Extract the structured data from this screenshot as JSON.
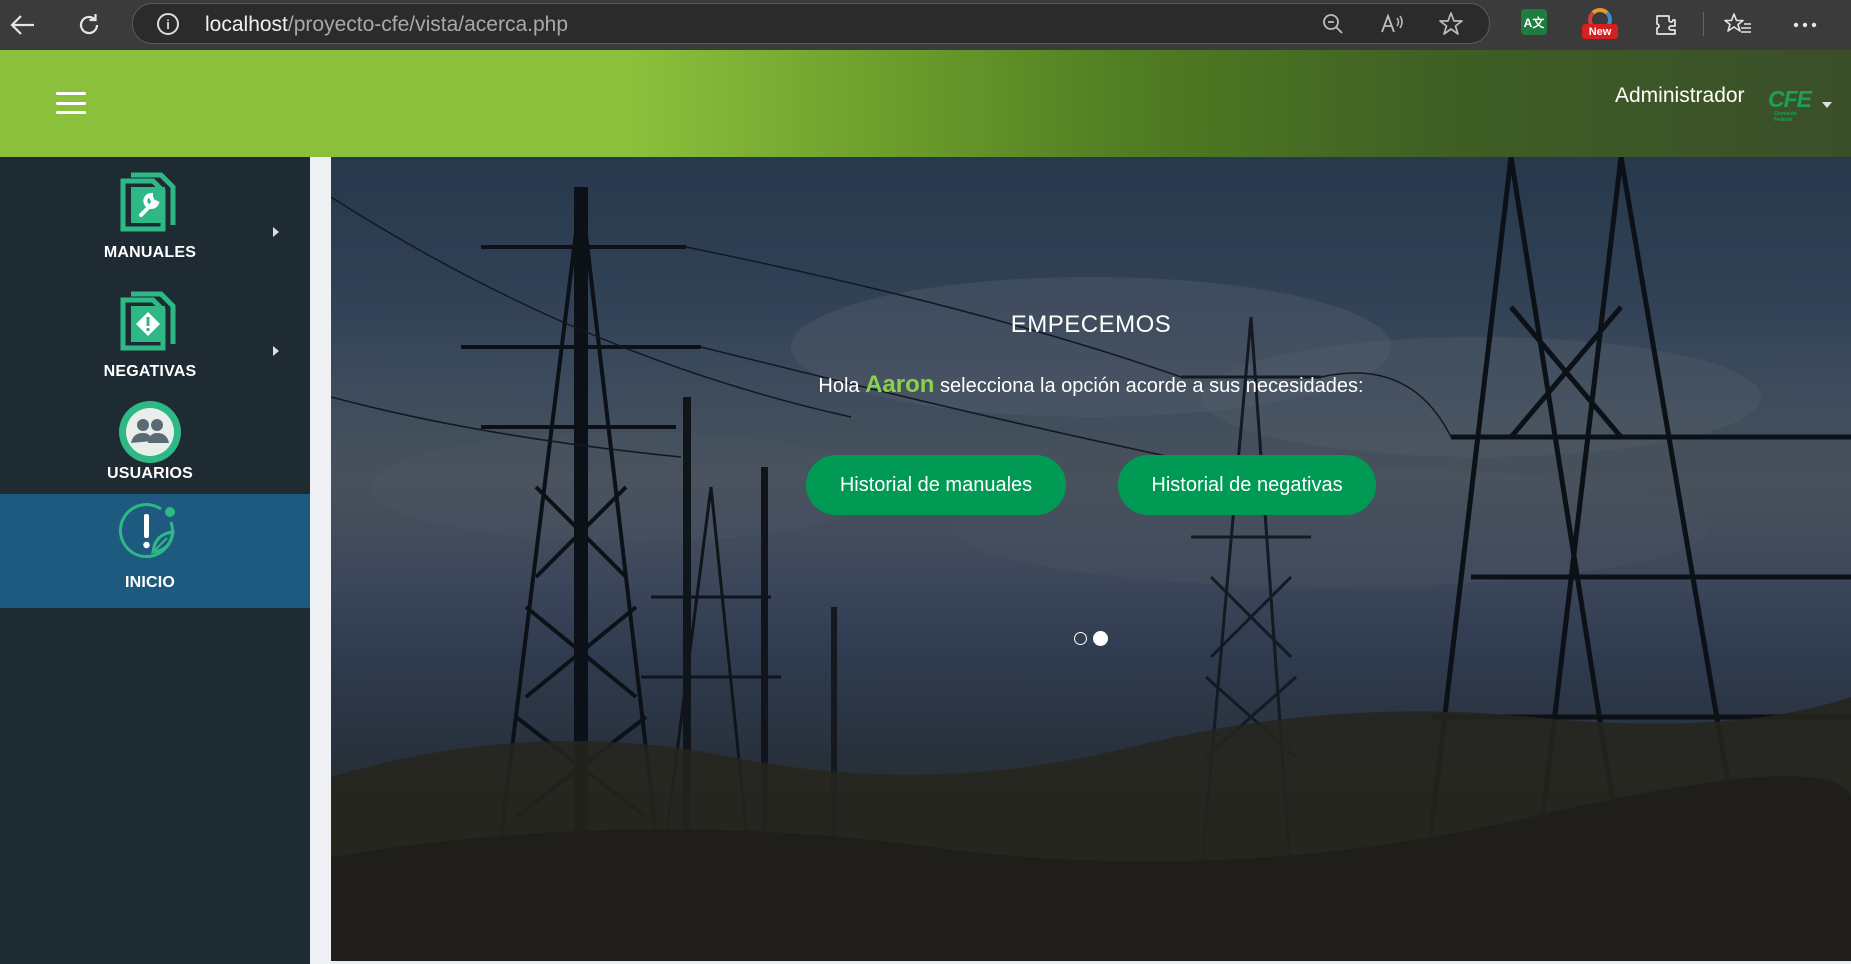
{
  "browser": {
    "url_host": "localhost",
    "url_path": "/proyecto-cfe/vista/acerca.php",
    "new_badge": "New",
    "translate_badge": "A文",
    "icons": [
      "back-icon",
      "refresh-icon",
      "info-icon",
      "zoom-out-icon",
      "read-aloud-icon",
      "favorite-star-icon",
      "translate-extension-icon",
      "new-extension-icon",
      "extensions-puzzle-icon",
      "favorites-list-icon",
      "more-options-icon"
    ]
  },
  "header": {
    "user_label": "Administrador",
    "logo_text": "CFE",
    "logo_tagline": "Comisión Federal",
    "colors": {
      "bar_start": "#8bc03c",
      "bar_end": "#3a4e2a"
    }
  },
  "sidebar": {
    "items": [
      {
        "label": "MANUALES",
        "icon": "manual-wrench-icon",
        "has_submenu": true
      },
      {
        "label": "NEGATIVAS",
        "icon": "negative-warning-icon",
        "has_submenu": true
      },
      {
        "label": "USUARIOS",
        "icon": "users-icon",
        "has_submenu": false
      },
      {
        "label": "INICIO",
        "icon": "home-leaf-alert-icon",
        "has_submenu": false,
        "active": true
      }
    ],
    "colors": {
      "background": "#1e2b33",
      "active": "#1e5a80",
      "accent": "#2eb886"
    }
  },
  "hero": {
    "title": "EMPECEMOS",
    "greeting_prefix": "Hola",
    "user_name": "Aaron",
    "greeting_suffix": "selecciona la opción acorde a sus necesidades:",
    "buttons": [
      "Historial de manuales",
      "Historial de negativas"
    ],
    "carousel": {
      "slides": 2,
      "active_slide": 2
    },
    "colors": {
      "button": "#009a55",
      "name": "#8bd04a"
    }
  }
}
